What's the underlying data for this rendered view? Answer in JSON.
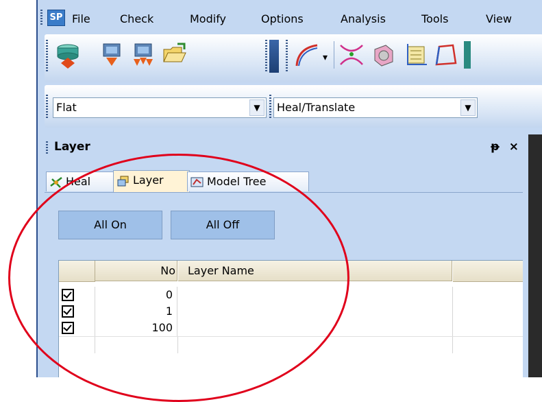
{
  "app": {
    "icon_text": "SP"
  },
  "menu": [
    {
      "label": "File"
    },
    {
      "label": "Check"
    },
    {
      "label": "Modify"
    },
    {
      "label": "Options"
    },
    {
      "label": "Analysis"
    },
    {
      "label": "Tools"
    },
    {
      "label": "View"
    }
  ],
  "toolbar": {
    "icons": [
      "cylinder-import-icon",
      "import-down-icon",
      "import-split-icon",
      "open-folder-icon",
      "curve-icon",
      "intersect-icon",
      "solid-icon",
      "axes-icon",
      "frame-icon"
    ]
  },
  "combos": {
    "display_mode": {
      "value": "Flat"
    },
    "operation": {
      "value": "Heal/Translate"
    }
  },
  "panel": {
    "title": "Layer",
    "pin_label": "ᵾ",
    "close_label": "×"
  },
  "tabs": [
    {
      "label": "Heal",
      "icon": "heal-icon"
    },
    {
      "label": "Layer",
      "icon": "layer-icon",
      "active": true
    },
    {
      "label": "Model Tree",
      "icon": "model-tree-icon"
    }
  ],
  "buttons": {
    "all_on": "All On",
    "all_off": "All Off"
  },
  "grid": {
    "headers": {
      "check": "",
      "no": "No",
      "name": "Layer Name",
      "extra": ""
    },
    "rows": [
      {
        "checked": true,
        "no": "0",
        "name": ""
      },
      {
        "checked": true,
        "no": "1",
        "name": ""
      },
      {
        "checked": true,
        "no": "100",
        "name": ""
      }
    ]
  },
  "colors": {
    "panel_bg": "#c4d8f2",
    "annotation": "#e0001b",
    "active_tab": "#fff3d6"
  }
}
